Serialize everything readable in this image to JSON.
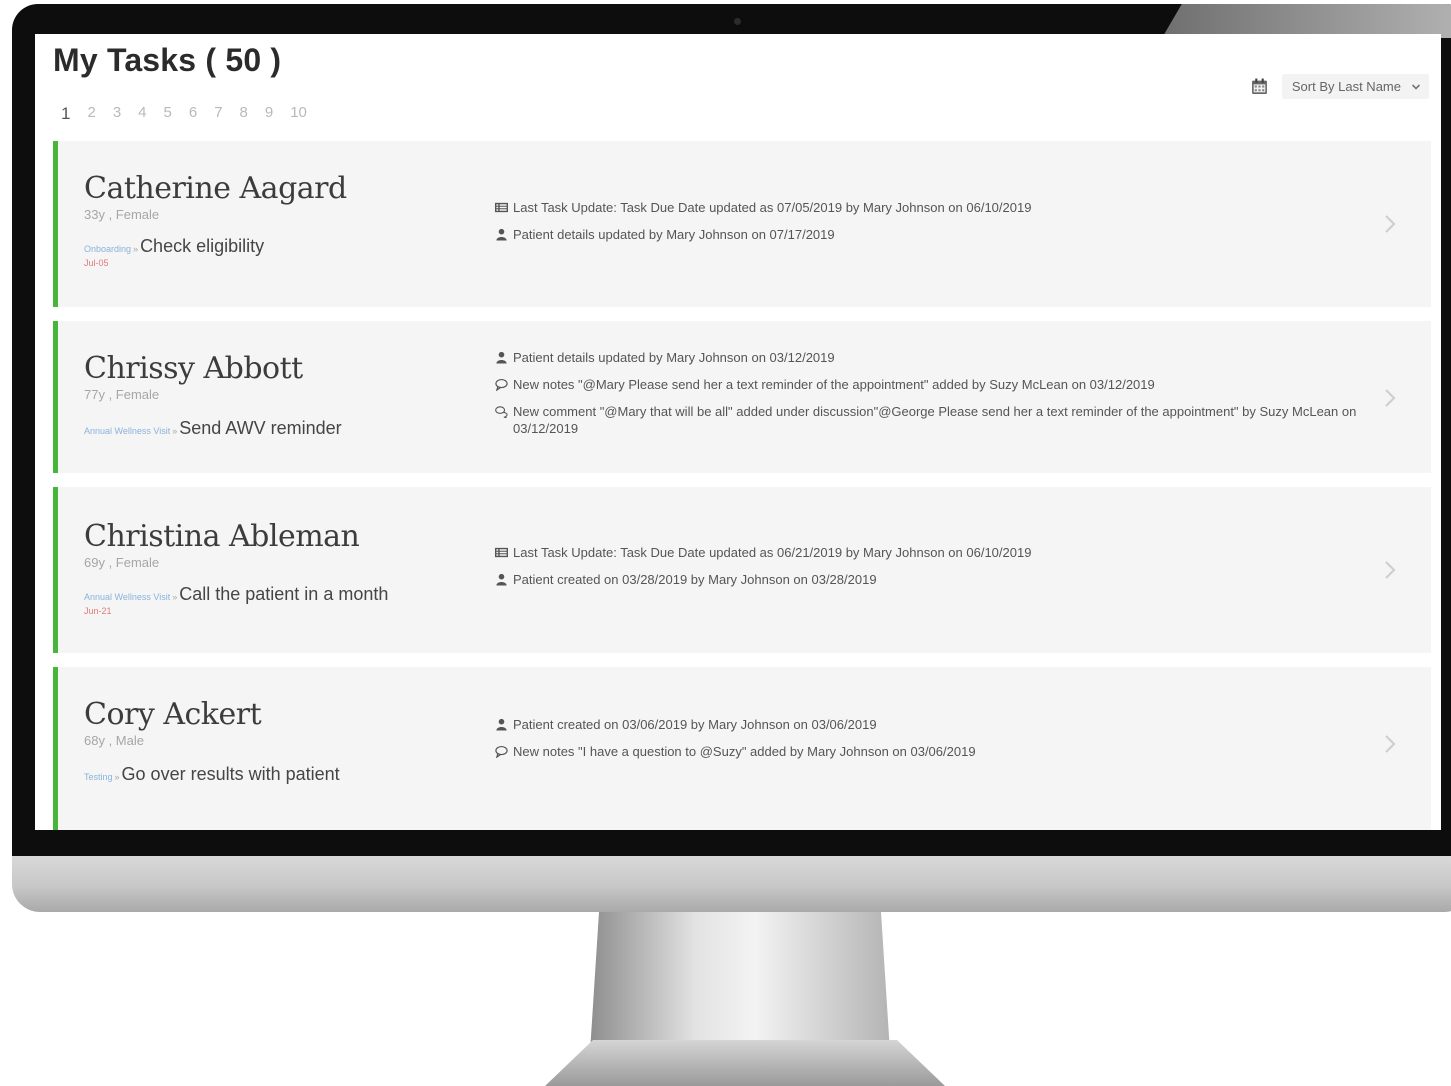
{
  "header": {
    "title": "My Tasks ( 50 )",
    "pages": [
      "1",
      "2",
      "3",
      "4",
      "5",
      "6",
      "7",
      "8",
      "9",
      "10"
    ],
    "active_page": "1",
    "sort_label": "Sort By Last Name",
    "calendar_icon": "calendar-icon",
    "sort_icon": "chevron-down-icon"
  },
  "colors": {
    "accent_green": "#46b53a",
    "category_blue": "#8ab2dd",
    "due_red": "#e27a7a",
    "card_bg": "#f5f5f5"
  },
  "tasks": [
    {
      "name": "Catherine Aagard",
      "meta": "33y , Female",
      "category": "Onboarding",
      "separator": "»",
      "task": "Check eligibility",
      "due": "Jul-05",
      "updates": [
        {
          "icon": "list-icon",
          "text": "Last Task Update: Task Due Date updated as 07/05/2019 by Mary Johnson on 06/10/2019"
        },
        {
          "icon": "user-icon",
          "text": "Patient details updated by Mary Johnson on 07/17/2019"
        }
      ]
    },
    {
      "name": "Chrissy Abbott",
      "meta": "77y , Female",
      "category": "Annual Wellness Visit",
      "separator": "»",
      "task": "Send AWV reminder",
      "due": "",
      "updates": [
        {
          "icon": "user-icon",
          "text": "Patient details updated by Mary Johnson on 03/12/2019"
        },
        {
          "icon": "comment-icon",
          "text": "New notes \"@Mary Please send her a text reminder of the appointment\" added by Suzy McLean on 03/12/2019"
        },
        {
          "icon": "comments-icon",
          "text": "New comment \"@Mary that will be all\" added under discussion\"@George Please send her a text reminder of the appointment\" by Suzy McLean on 03/12/2019"
        }
      ]
    },
    {
      "name": "Christina Ableman",
      "meta": "69y , Female",
      "category": "Annual Wellness Visit",
      "separator": "»",
      "task": "Call the patient in a month",
      "due": "Jun-21",
      "updates": [
        {
          "icon": "list-icon",
          "text": "Last Task Update: Task Due Date updated as 06/21/2019 by Mary Johnson on 06/10/2019"
        },
        {
          "icon": "user-icon",
          "text": "Patient created on 03/28/2019 by Mary Johnson on 03/28/2019"
        }
      ]
    },
    {
      "name": "Cory Ackert",
      "meta": "68y , Male",
      "category": "Testing",
      "separator": "»",
      "task": "Go over results with patient",
      "due": "",
      "updates": [
        {
          "icon": "user-icon",
          "text": "Patient created on 03/06/2019 by Mary Johnson on 03/06/2019"
        },
        {
          "icon": "comment-icon",
          "text": "New notes \"I have a question to @Suzy\" added by Mary Johnson on 03/06/2019"
        }
      ]
    }
  ]
}
